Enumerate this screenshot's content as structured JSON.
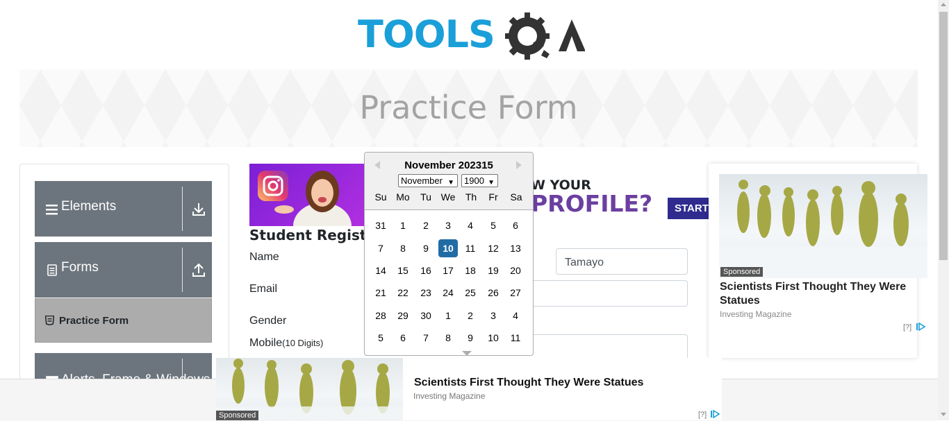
{
  "header": {
    "logo_text": "TOOLS",
    "logo_text_2": "QA"
  },
  "banner": {
    "title": "Practice Form"
  },
  "sidebar": {
    "groups": [
      {
        "label": "Elements"
      },
      {
        "label": "Forms"
      },
      {
        "label": "Alerts, Frame & Windows"
      }
    ],
    "active_item": "Practice Form"
  },
  "top_ad": {
    "line1": "W YOUR",
    "line2": "PROFILE?",
    "cta": "START"
  },
  "form": {
    "title": "Student Registratio",
    "name_label": "Name",
    "last_name_value": "Tamayo",
    "email_label": "Email",
    "gender_label": "Gender",
    "mobile_label": "Mobile",
    "mobile_hint": "(10 Digits)"
  },
  "datepicker": {
    "header": "November 202315",
    "month_select": "November",
    "year_select": "1900",
    "weekdays": [
      "Su",
      "Mo",
      "Tu",
      "We",
      "Th",
      "Fr",
      "Sa"
    ],
    "weeks": [
      [
        "31",
        "1",
        "2",
        "3",
        "4",
        "5",
        "6"
      ],
      [
        "7",
        "8",
        "9",
        "10",
        "11",
        "12",
        "13"
      ],
      [
        "14",
        "15",
        "16",
        "17",
        "18",
        "19",
        "20"
      ],
      [
        "21",
        "22",
        "23",
        "24",
        "25",
        "26",
        "27"
      ],
      [
        "28",
        "29",
        "30",
        "1",
        "2",
        "3",
        "4"
      ],
      [
        "5",
        "6",
        "7",
        "8",
        "9",
        "10",
        "11"
      ]
    ],
    "selected": "10"
  },
  "right_ad": {
    "sponsored": "Sponsored",
    "title": "Scientists First Thought They Were Statues",
    "source": "Investing Magazine",
    "info": "[?]"
  },
  "bottom_ad": {
    "sponsored": "Sponsored",
    "title": "Scientists First Thought They Were Statues",
    "source": "Investing Magazine",
    "info": "[?]"
  },
  "colors": {
    "brand_blue": "#1a9fd9",
    "group_bg": "#6c757d",
    "selected_day": "#216ba5"
  }
}
